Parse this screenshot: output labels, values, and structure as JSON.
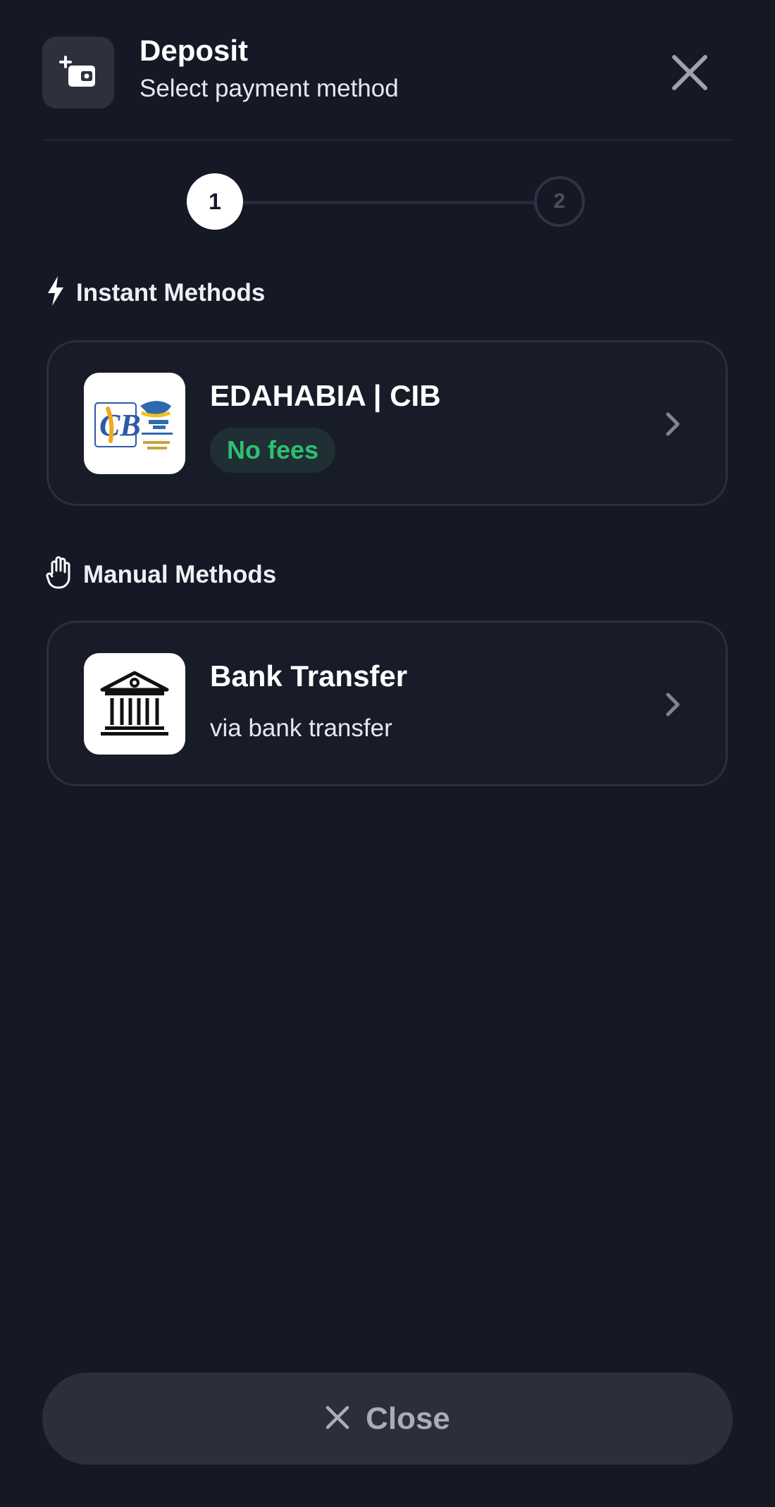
{
  "header": {
    "title": "Deposit",
    "subtitle": "Select payment method",
    "icon": "wallet-plus-icon",
    "close_icon": "close-icon"
  },
  "stepper": {
    "steps": [
      {
        "label": "1",
        "state": "active"
      },
      {
        "label": "2",
        "state": "inactive"
      }
    ]
  },
  "sections": {
    "instant": {
      "label": "Instant Methods",
      "icon": "lightning-icon",
      "methods": [
        {
          "title": "EDAHABIA | CIB",
          "badge": "No fees",
          "logo": "edahabia-cib-logo"
        }
      ]
    },
    "manual": {
      "label": "Manual Methods",
      "icon": "hand-icon",
      "methods": [
        {
          "title": "Bank Transfer",
          "subtitle": "via bank transfer",
          "logo": "bank-icon"
        }
      ]
    }
  },
  "footer": {
    "close_label": "Close",
    "close_icon": "close-icon"
  },
  "colors": {
    "background": "#151926",
    "card_border": "#2b2f3c",
    "badge_text": "#2dbf73",
    "badge_bg": "#1f2f33",
    "button_bg": "#2b2e3b"
  }
}
